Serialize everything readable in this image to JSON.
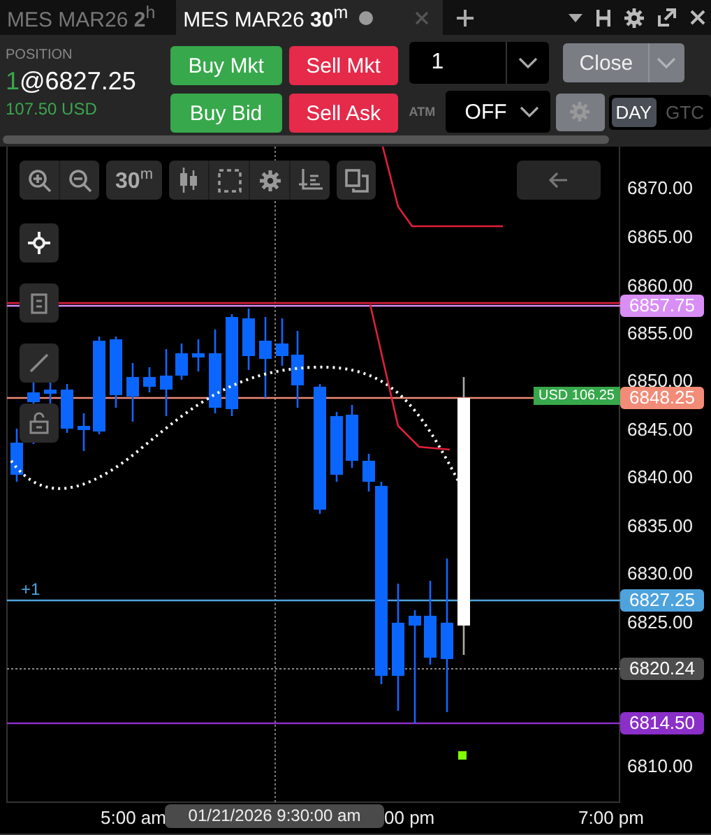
{
  "tabs": [
    {
      "label": "MES MAR26 **2**$^{h}$",
      "selected": false
    },
    {
      "label": "MES MAR26 **30**$^{m}$",
      "selected": true
    }
  ],
  "order_panel": {
    "position_label": "POSITION",
    "position_quantity": "1",
    "position_price": "@6827.25",
    "pnl": "107.50 USD",
    "order_buttons": [
      {
        "label": "Buy Mkt",
        "kind": "buy"
      },
      {
        "label": "Sell Mkt",
        "kind": "sell"
      },
      {
        "label": "Buy Bid",
        "kind": "buy"
      },
      {
        "label": "Sell Ask",
        "kind": "sell"
      }
    ],
    "quantity": "1",
    "close_button": "Close",
    "atm_label": "ATM",
    "atm_value": "OFF",
    "time_in_force": [
      {
        "label": "DAY",
        "selected": true
      },
      {
        "label": "GTC",
        "selected": false
      }
    ]
  },
  "chart": {
    "interval_button": "30$^{m}$",
    "position_marker": "+1",
    "pnl_label": "USD 106.25",
    "price_axis": [
      "6870.00",
      "6865.00",
      "6860.00",
      "6855.00",
      "6850.00",
      "6845.00",
      "6840.00",
      "6835.00",
      "6830.00",
      "6825.00",
      "6810.00"
    ],
    "price_tags": [
      {
        "label": "6857.75",
        "color": "#d98ef5"
      },
      {
        "label": "6848.25",
        "color": "#f28b77"
      },
      {
        "label": "6827.25",
        "color": "#4fa3dd"
      },
      {
        "label": "6820.24",
        "color": "#4d4d4d"
      },
      {
        "label": "6814.50",
        "color": "#8b2fc9"
      }
    ],
    "time_axis": [
      "5:00 am",
      "00 pm",
      "7:00 pm"
    ],
    "crosshair_time": "01/21/2026 9:30:00 am"
  }
}
